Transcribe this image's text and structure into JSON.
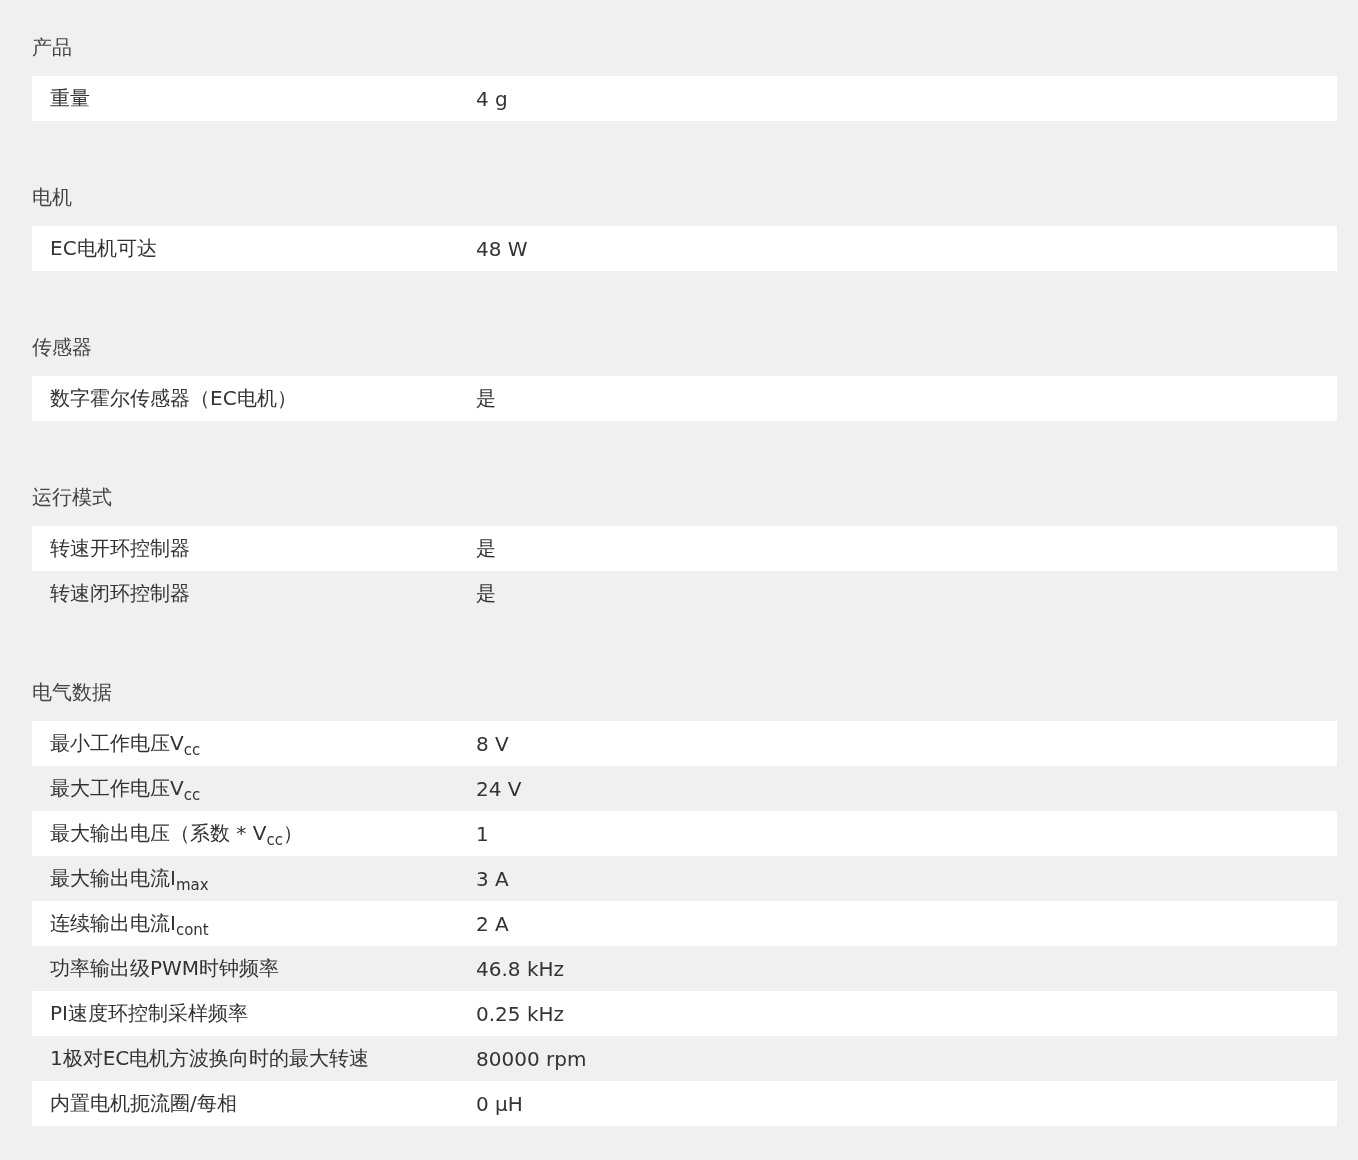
{
  "sections": [
    {
      "title": "产品",
      "rows": [
        {
          "label": "重量",
          "value": "4 g"
        }
      ]
    },
    {
      "title": "电机",
      "rows": [
        {
          "label": "EC电机可达",
          "value": "48 W"
        }
      ]
    },
    {
      "title": "传感器",
      "rows": [
        {
          "label": "数字霍尔传感器（EC电机）",
          "value": "是"
        }
      ]
    },
    {
      "title": "运行模式",
      "rows": [
        {
          "label": "转速开环控制器",
          "value": "是"
        },
        {
          "label": "转速闭环控制器",
          "value": "是"
        }
      ]
    },
    {
      "title": "电气数据",
      "rows": [
        {
          "label": "最小工作电压V$_{cc}$",
          "value": "8 V"
        },
        {
          "label": "最大工作电压V$_{cc}$",
          "value": "24 V"
        },
        {
          "label": "最大输出电压（系数 * V$_{cc}$）",
          "value": "1"
        },
        {
          "label": "最大输出电流I$_{max}$",
          "value": "3 A"
        },
        {
          "label": "连续输出电流I$_{cont}$",
          "value": "2 A"
        },
        {
          "label": "功率输出级PWM时钟频率",
          "value": "46.8 kHz"
        },
        {
          "label": "PI速度环控制采样频率",
          "value": "0.25 kHz"
        },
        {
          "label": "1极对EC电机方波换向时的最大转速",
          "value": "80000 rpm"
        },
        {
          "label": "内置电机扼流圈/每相",
          "value": "0 µH"
        }
      ]
    }
  ]
}
